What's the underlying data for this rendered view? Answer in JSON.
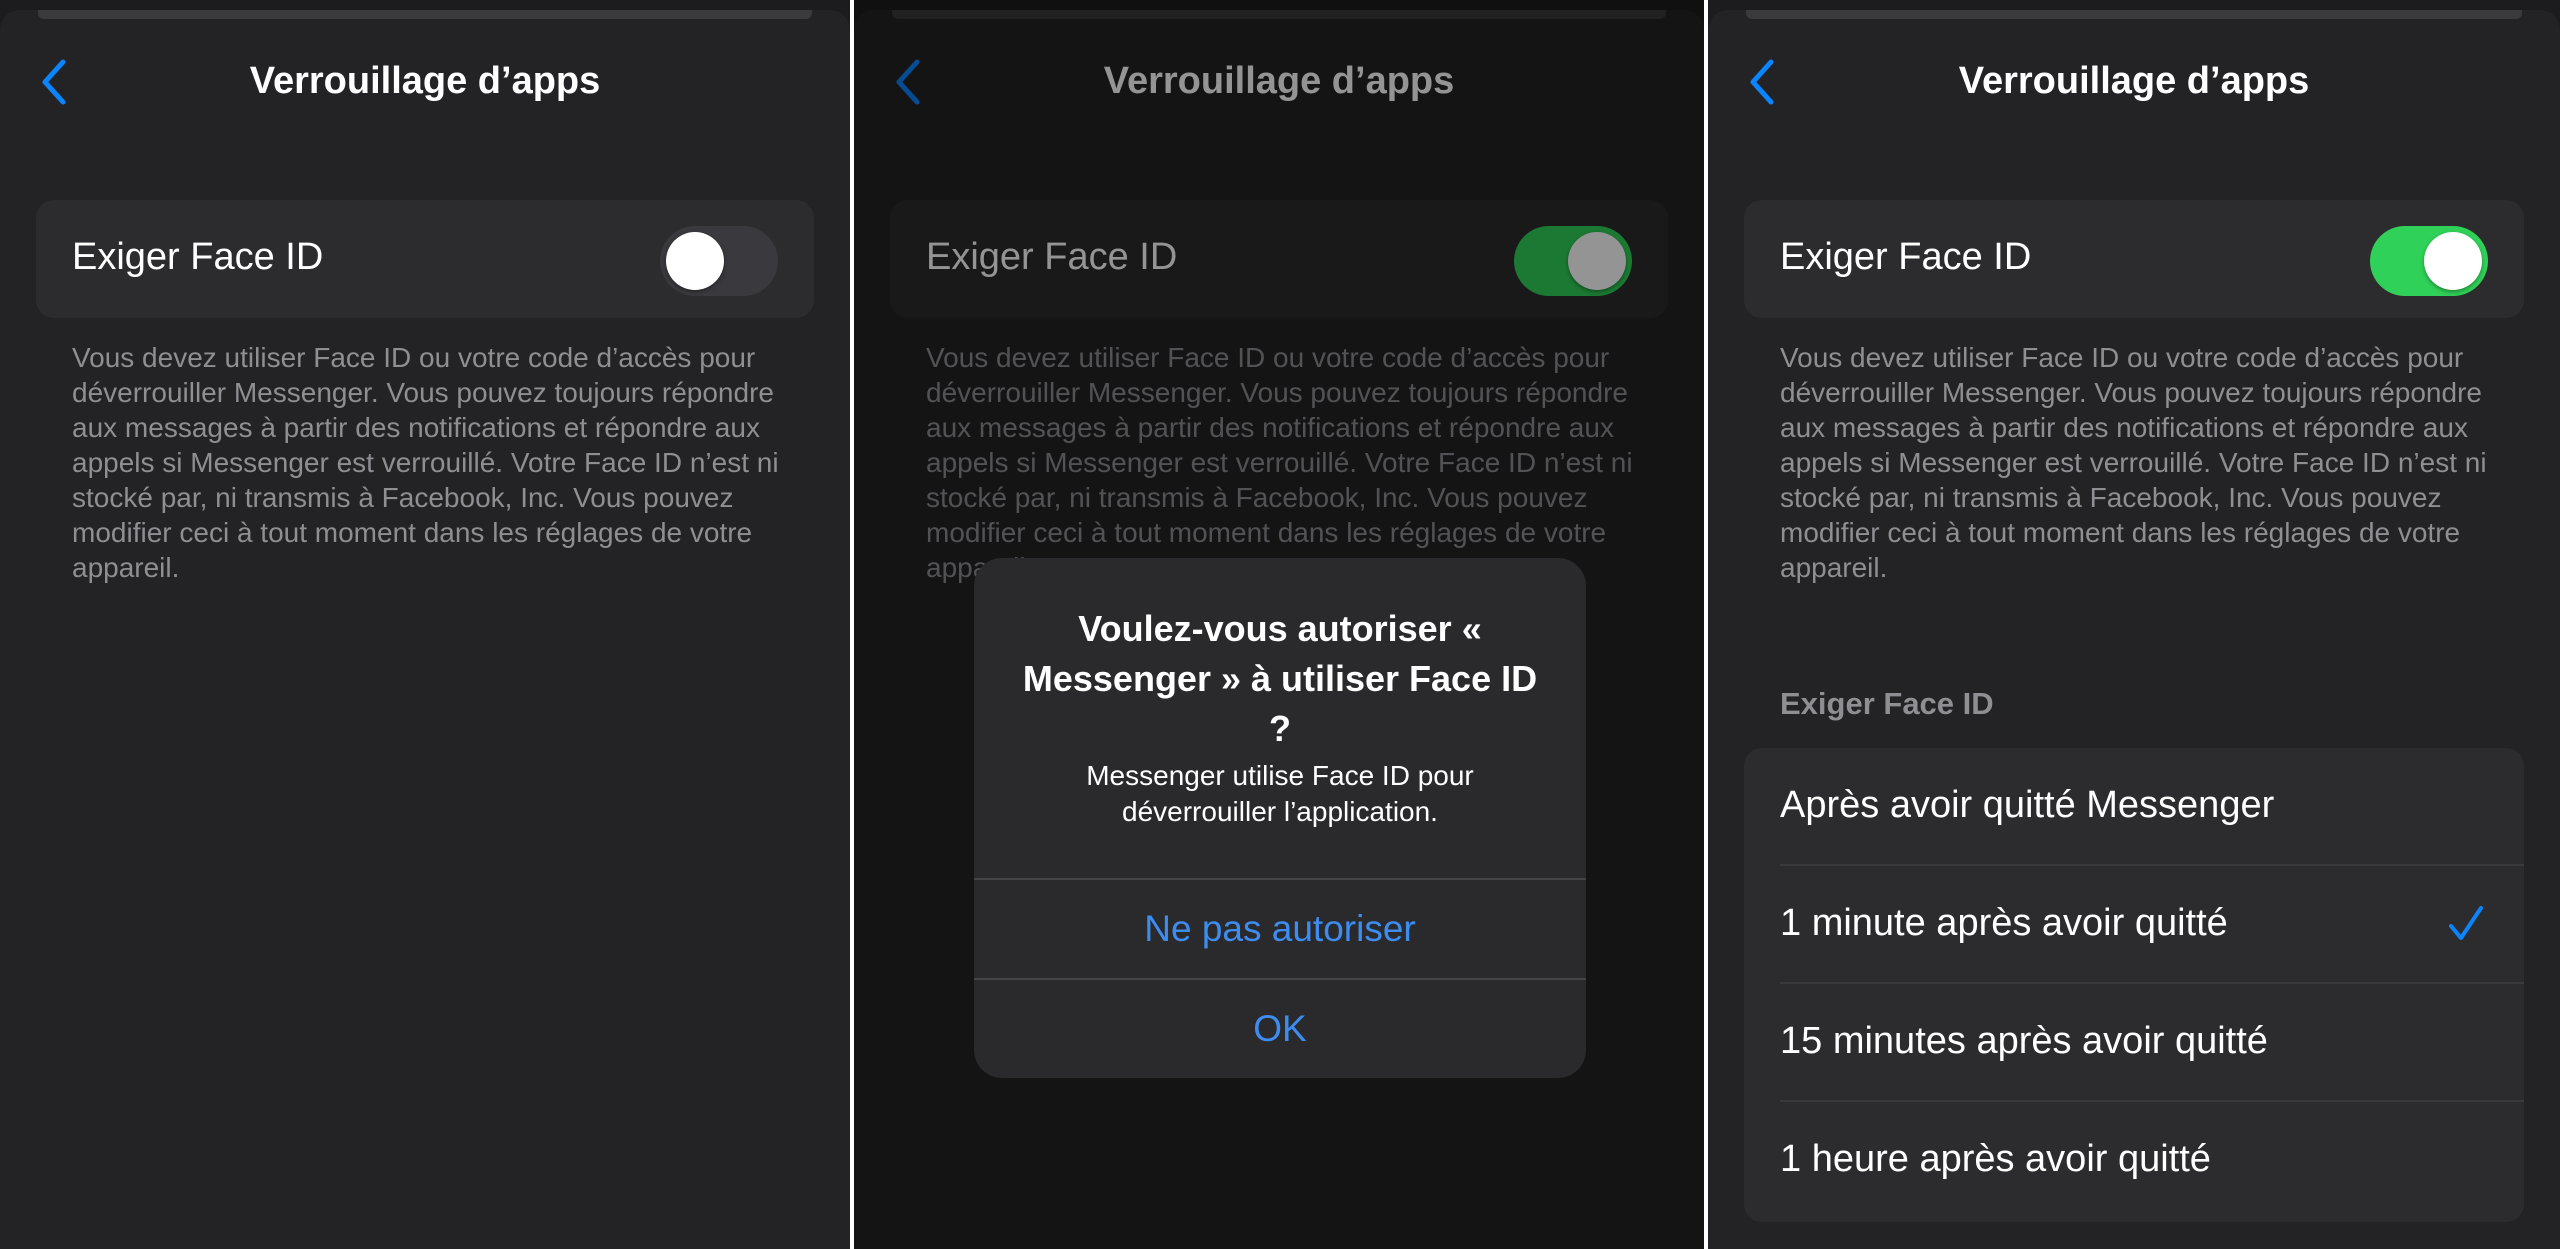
{
  "colors": {
    "accent": "#0a84ff",
    "toggle_on": "#30d158",
    "background": "#1c1c1e"
  },
  "panel1": {
    "title": "Verrouillage d’apps",
    "toggle_label": "Exiger Face ID",
    "toggle_state": "off",
    "description": "Vous devez utiliser Face ID ou votre code d’accès pour déverrouiller Messenger. Vous pouvez toujours répondre aux messages à partir des notifications et répondre aux appels si Messenger est verrouillé. Votre Face ID n’est ni stocké par, ni transmis à Facebook, Inc. Vous pouvez modifier ceci à tout moment dans les réglages de votre appareil."
  },
  "panel2": {
    "title": "Verrouillage d’apps",
    "toggle_label": "Exiger Face ID",
    "toggle_state": "on",
    "description": "Vous devez utiliser Face ID ou votre code d’accès pour déverrouiller Messenger. Vous pouvez toujours répondre aux messages à partir des notifications et répondre aux appels si Messenger est verrouillé. Votre Face ID n’est ni stocké par, ni transmis à Facebook, Inc. Vous pouvez modifier ceci à tout moment dans les réglages de votre appareil.",
    "alert": {
      "title": "Voulez-vous autoriser « Messenger » à utiliser Face ID ?",
      "message": "Messenger utilise Face ID pour déverrouiller l’application.",
      "deny_label": "Ne pas autoriser",
      "ok_label": "OK"
    }
  },
  "panel3": {
    "title": "Verrouillage d’apps",
    "toggle_label": "Exiger Face ID",
    "toggle_state": "on",
    "description": "Vous devez utiliser Face ID ou votre code d’accès pour déverrouiller Messenger. Vous pouvez toujours répondre aux messages à partir des notifications et répondre aux appels si Messenger est verrouillé. Votre Face ID n’est ni stocké par, ni transmis à Facebook, Inc. Vous pouvez modifier ceci à tout moment dans les réglages de votre appareil.",
    "section_header": "Exiger Face ID",
    "options": [
      {
        "label": "Après avoir quitté Messenger",
        "selected": false
      },
      {
        "label": "1 minute après avoir quitté",
        "selected": true
      },
      {
        "label": "15 minutes après avoir quitté",
        "selected": false
      },
      {
        "label": "1 heure après avoir quitté",
        "selected": false
      }
    ]
  }
}
